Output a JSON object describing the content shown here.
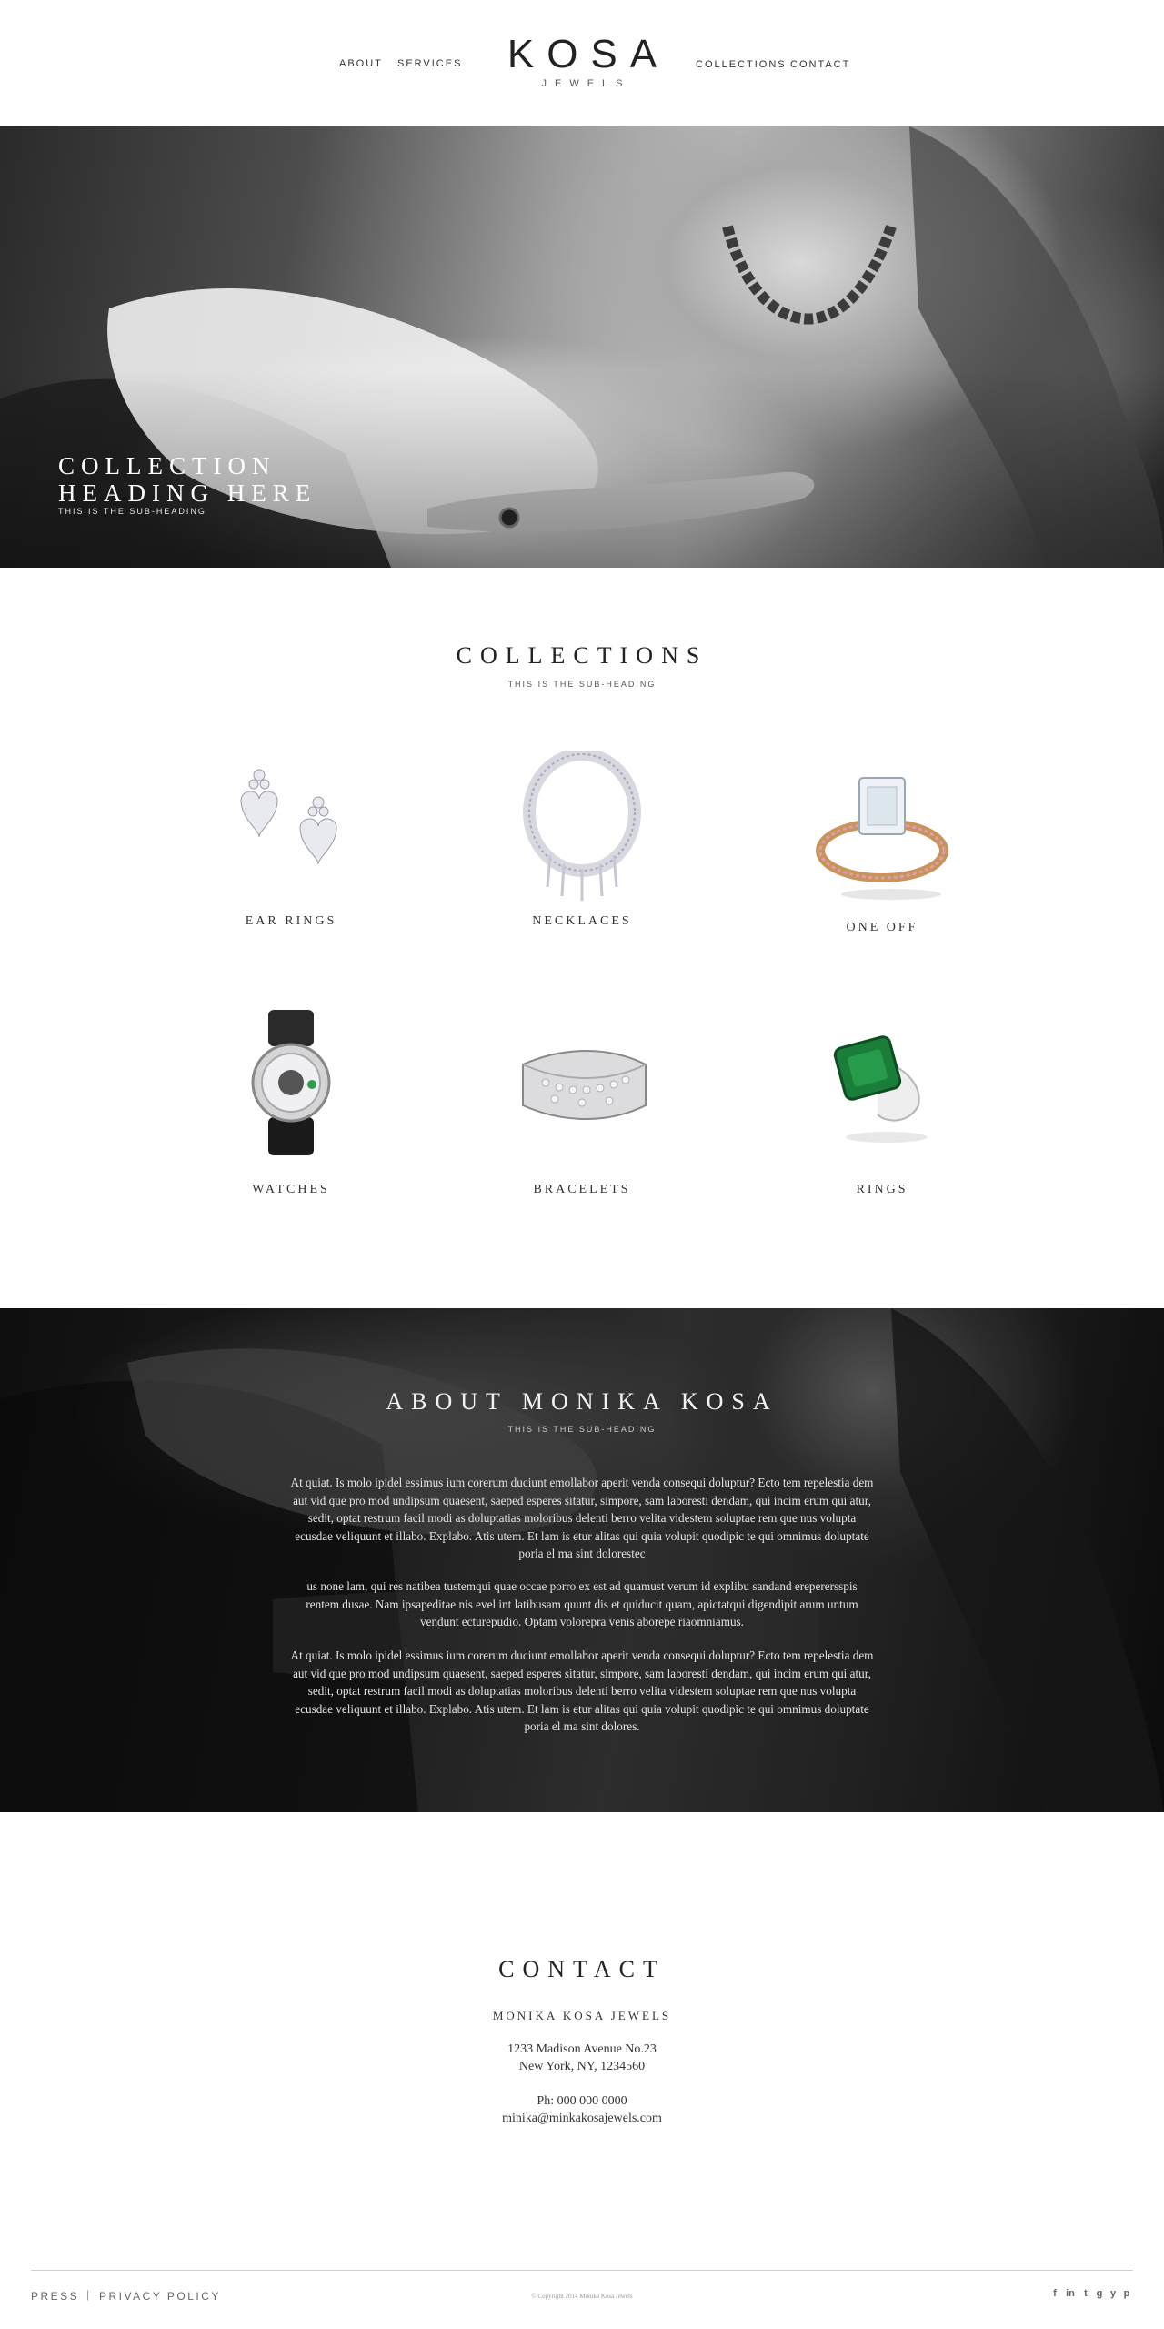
{
  "header": {
    "nav_left": [
      "ABOUT",
      "SERVICES"
    ],
    "nav_right": [
      "COLLECTIONS",
      "CONTACT"
    ],
    "logo_main": "KOSA",
    "logo_sub": "JEWELS"
  },
  "hero": {
    "title_line1": "COLLECTION",
    "title_line2": "HEADING HERE",
    "subheading": "THIS IS THE SUB-HEADING"
  },
  "collections": {
    "title": "COLLECTIONS",
    "subheading": "THIS IS THE SUB-HEADING",
    "items": [
      {
        "label": "EAR RINGS",
        "icon": "earrings-image"
      },
      {
        "label": "NECKLACES",
        "icon": "necklace-image"
      },
      {
        "label": "ONE OFF",
        "icon": "diamond-ring-image"
      },
      {
        "label": "WATCHES",
        "icon": "watch-image"
      },
      {
        "label": "BRACELETS",
        "icon": "bracelet-image"
      },
      {
        "label": "RINGS",
        "icon": "emerald-ring-image"
      }
    ]
  },
  "about": {
    "title": "ABOUT MONIKA KOSA",
    "subheading": "THIS IS THE SUB-HEADING",
    "paragraphs": [
      "At quiat. Is molo ipidel essimus ium corerum duciunt emollabor aperit venda consequi doluptur? Ecto tem repelestia dem aut vid que pro mod undipsum quaesent, saeped esperes sitatur, simpore, sam laboresti dendam, qui incim erum qui atur, sedit, optat restrum facil modi as doluptatias moloribus delenti berro velita videstem soluptae rem que nus volupta ecusdae veliquunt et illabo. Explabo. Atis utem. Et lam is etur alitas qui quia volupit quodipic te qui omnimus doluptate poria el ma sint dolorestec",
      "us none lam, qui res natibea tustemqui quae occae porro ex est ad quamust verum id explibu sandand ereperersspis rentem dusae. Nam ipsapeditae nis evel int latibusam quunt dis et quiducit quam, apictatqui digendipit arum untum vendunt ecturepudio. Optam volorepra venis aborepe riaomniamus.",
      "At quiat. Is molo ipidel essimus ium corerum duciunt emollabor aperit venda consequi doluptur? Ecto tem repelestia dem aut vid que pro mod undipsum quaesent, saeped esperes sitatur, simpore, sam laboresti dendam, qui incim erum qui atur, sedit, optat restrum facil modi as doluptatias moloribus delenti berro velita videstem soluptae rem que nus volupta ecusdae veliquunt et illabo. Explabo. Atis utem. Et lam is etur alitas qui quia volupit quodipic te qui omnimus doluptate poria el ma sint dolores."
    ]
  },
  "contact": {
    "title": "CONTACT",
    "company": "MONIKA KOSA JEWELS",
    "address_line1": "1233 Madison Avenue No.23",
    "address_line2": "New York, NY, 1234560",
    "phone": "Ph: 000 000 0000",
    "email": "minika@minkakosajewels.com"
  },
  "footer": {
    "press": "PRESS",
    "separator": "|",
    "privacy": "PRIVACY POLICY",
    "copyright": "© Copyright 2014 Monika Kosa Jewels",
    "social": [
      {
        "glyph": "f",
        "icon": "facebook-icon"
      },
      {
        "glyph": "in",
        "icon": "linkedin-icon"
      },
      {
        "glyph": "t",
        "icon": "tumblr-icon"
      },
      {
        "glyph": "g",
        "icon": "google-plus-icon"
      },
      {
        "glyph": "y",
        "icon": "twitter-icon"
      },
      {
        "glyph": "p",
        "icon": "pinterest-icon"
      }
    ]
  }
}
